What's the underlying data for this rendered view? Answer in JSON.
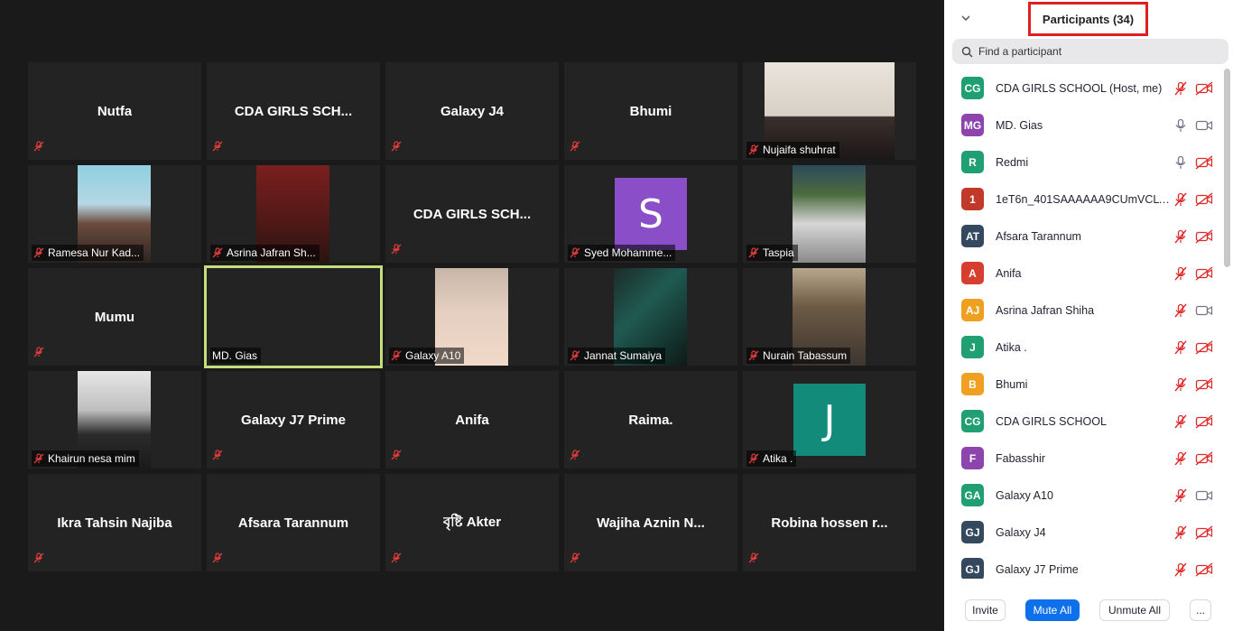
{
  "gallery": {
    "tiles": [
      {
        "name": "Nutfa",
        "display": "Nutfa",
        "kind": "name"
      },
      {
        "name": "CDA GIRLS SCH...",
        "display": "CDA GIRLS SCH...",
        "kind": "name"
      },
      {
        "name": "Galaxy J4",
        "display": "Galaxy J4",
        "kind": "name"
      },
      {
        "name": "Bhumi",
        "display": "Bhumi",
        "kind": "name"
      },
      {
        "name": "Nujaifa shuhrat",
        "kind": "video"
      },
      {
        "name": "Ramesa Nur Kad...",
        "kind": "video"
      },
      {
        "name": "Asrina Jafran  Sh...",
        "kind": "video"
      },
      {
        "name": "CDA GIRLS SCH...",
        "display": "CDA GIRLS SCH...",
        "kind": "name"
      },
      {
        "name": "Syed Mohamme...",
        "kind": "avatar",
        "letter": "S",
        "color": "#8a4fc8"
      },
      {
        "name": "Taspia",
        "kind": "video"
      },
      {
        "name": "Mumu",
        "display": "Mumu",
        "kind": "name"
      },
      {
        "name": "MD. Gias",
        "kind": "active"
      },
      {
        "name": "Galaxy A10",
        "kind": "video"
      },
      {
        "name": "Jannat Sumaiya",
        "kind": "video"
      },
      {
        "name": "Nurain Tabassum",
        "kind": "video"
      },
      {
        "name": "Khairun nesa mim",
        "kind": "video"
      },
      {
        "name": "Galaxy J7 Prime",
        "display": "Galaxy J7 Prime",
        "kind": "name"
      },
      {
        "name": "Anifa",
        "display": "Anifa",
        "kind": "name"
      },
      {
        "name": "Raima.",
        "display": "Raima.",
        "kind": "name"
      },
      {
        "name": "Atika .",
        "kind": "avatar",
        "letter": "J",
        "color": "#138b7a"
      },
      {
        "name": "Ikra Tahsin Najiba",
        "display": "Ikra Tahsin Najiba",
        "kind": "name"
      },
      {
        "name": "Afsara Tarannum",
        "display": "Afsara Tarannum",
        "kind": "name"
      },
      {
        "name": "বৃষ্টি Akter",
        "display": "বৃষ্টি Akter",
        "kind": "name"
      },
      {
        "name": "Wajiha Aznin N...",
        "display": "Wajiha Aznin N...",
        "kind": "name"
      },
      {
        "name": "Robina hossen r...",
        "display": "Robina hossen r...",
        "kind": "name"
      }
    ]
  },
  "panel": {
    "title": "Participants (34)",
    "search_placeholder": "Find a participant",
    "participants": [
      {
        "initials": "CG",
        "color": "#1f9f72",
        "name": "CDA GIRLS SCHOOL (Host, me)",
        "mic": "off",
        "cam": "off"
      },
      {
        "initials": "MG",
        "color": "#8e44ad",
        "name": "MD. Gias",
        "mic": "on",
        "cam": "on"
      },
      {
        "initials": "R",
        "color": "#1f9f72",
        "name": "Redmi",
        "mic": "on",
        "cam": "off"
      },
      {
        "initials": "1",
        "color": "#c0392b",
        "name": "1eT6n_401SAAAAAA9CUmVCLW...",
        "mic": "off",
        "cam": "off"
      },
      {
        "initials": "AT",
        "color": "#34495e",
        "name": "Afsara Tarannum",
        "mic": "off",
        "cam": "off"
      },
      {
        "initials": "A",
        "color": "#d63f30",
        "name": "Anifa",
        "mic": "off",
        "cam": "off"
      },
      {
        "initials": "AJ",
        "color": "#f0a020",
        "name": "Asrina Jafran  Shiha",
        "mic": "off",
        "cam": "on"
      },
      {
        "initials": "J",
        "color": "#1f9f72",
        "name": "Atika .",
        "mic": "off",
        "cam": "off"
      },
      {
        "initials": "B",
        "color": "#f0a020",
        "name": "Bhumi",
        "mic": "off",
        "cam": "off"
      },
      {
        "initials": "CG",
        "color": "#1f9f72",
        "name": "CDA GIRLS SCHOOL",
        "mic": "off",
        "cam": "off"
      },
      {
        "initials": "F",
        "color": "#8e44ad",
        "name": "Fabasshir",
        "mic": "off",
        "cam": "off"
      },
      {
        "initials": "GA",
        "color": "#1f9f72",
        "name": "Galaxy A10",
        "mic": "off",
        "cam": "on"
      },
      {
        "initials": "GJ",
        "color": "#34495e",
        "name": "Galaxy J4",
        "mic": "off",
        "cam": "off"
      },
      {
        "initials": "GJ",
        "color": "#34495e",
        "name": "Galaxy J7 Prime",
        "mic": "off",
        "cam": "off"
      }
    ],
    "footer": {
      "invite": "Invite",
      "mute_all": "Mute All",
      "unmute_all": "Unmute All",
      "more": "..."
    }
  }
}
